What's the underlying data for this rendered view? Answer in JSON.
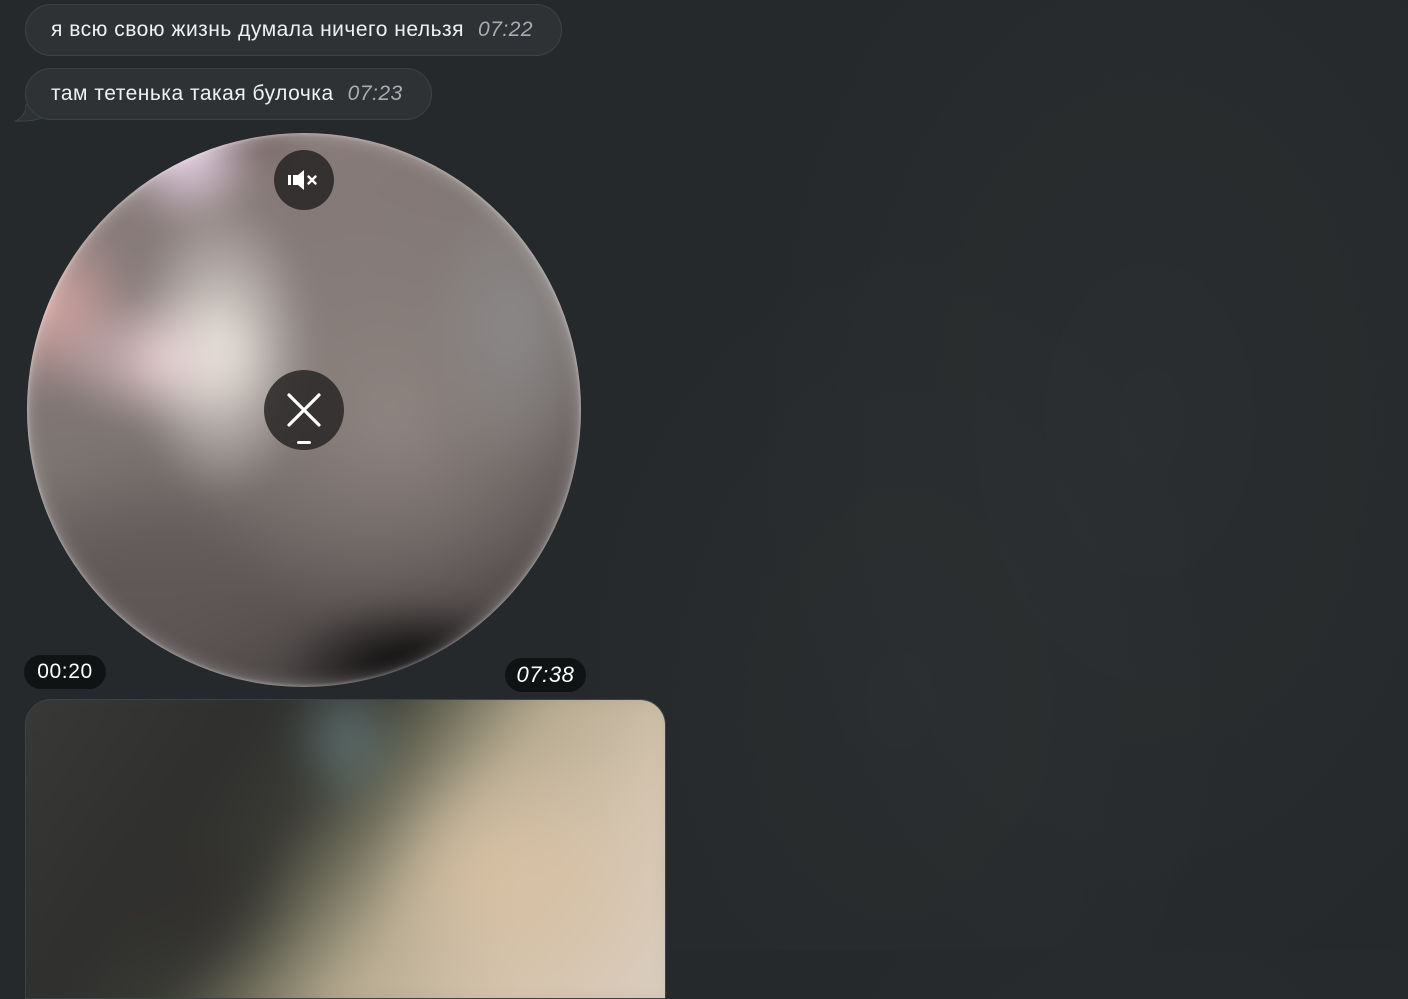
{
  "messages": [
    {
      "text": "я всю свою жизнь думала ничего нельзя",
      "time": "07:22"
    },
    {
      "text": "там тетенька такая булочка",
      "time": "07:23"
    }
  ],
  "video_message": {
    "duration": "00:20",
    "time": "07:38",
    "mute_icon": "speaker-muted-icon",
    "cancel_icon": "close-icon",
    "download_progress": 0.05
  },
  "photo_message": {
    "type": "photo"
  },
  "colors": {
    "background": "#25292b",
    "bubble": "#2e3234",
    "bubble_text": "#eef0f1",
    "timestamp": "#a9adb2"
  }
}
